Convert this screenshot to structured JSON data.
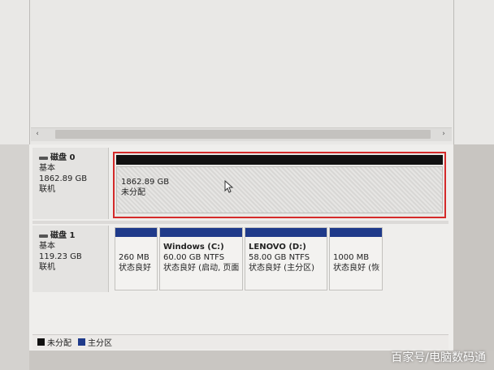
{
  "colors": {
    "unallocated": "#111111",
    "primary": "#1f3a8a",
    "highlight": "#d42a2a"
  },
  "disks": [
    {
      "name": "磁盘 0",
      "type": "基本",
      "size": "1862.89 GB",
      "status": "联机",
      "partitions": [
        {
          "size": "1862.89 GB",
          "state": "未分配"
        }
      ]
    },
    {
      "name": "磁盘 1",
      "type": "基本",
      "size": "119.23 GB",
      "status": "联机",
      "partitions": [
        {
          "title": "",
          "size": "260 MB",
          "state": "状态良好"
        },
        {
          "title": "Windows  (C:)",
          "size": "60.00 GB NTFS",
          "state": "状态良好 (启动, 页面"
        },
        {
          "title": "LENOVO  (D:)",
          "size": "58.00 GB NTFS",
          "state": "状态良好 (主分区)"
        },
        {
          "title": "",
          "size": "1000 MB",
          "state": "状态良好 (恢"
        }
      ]
    }
  ],
  "legend": [
    {
      "label": "未分配",
      "color": "#111111"
    },
    {
      "label": "主分区",
      "color": "#1f3a8a"
    }
  ],
  "scroll": {
    "left_arrow": "‹",
    "right_arrow": "›"
  },
  "watermark": "百家号/电脑数码通"
}
